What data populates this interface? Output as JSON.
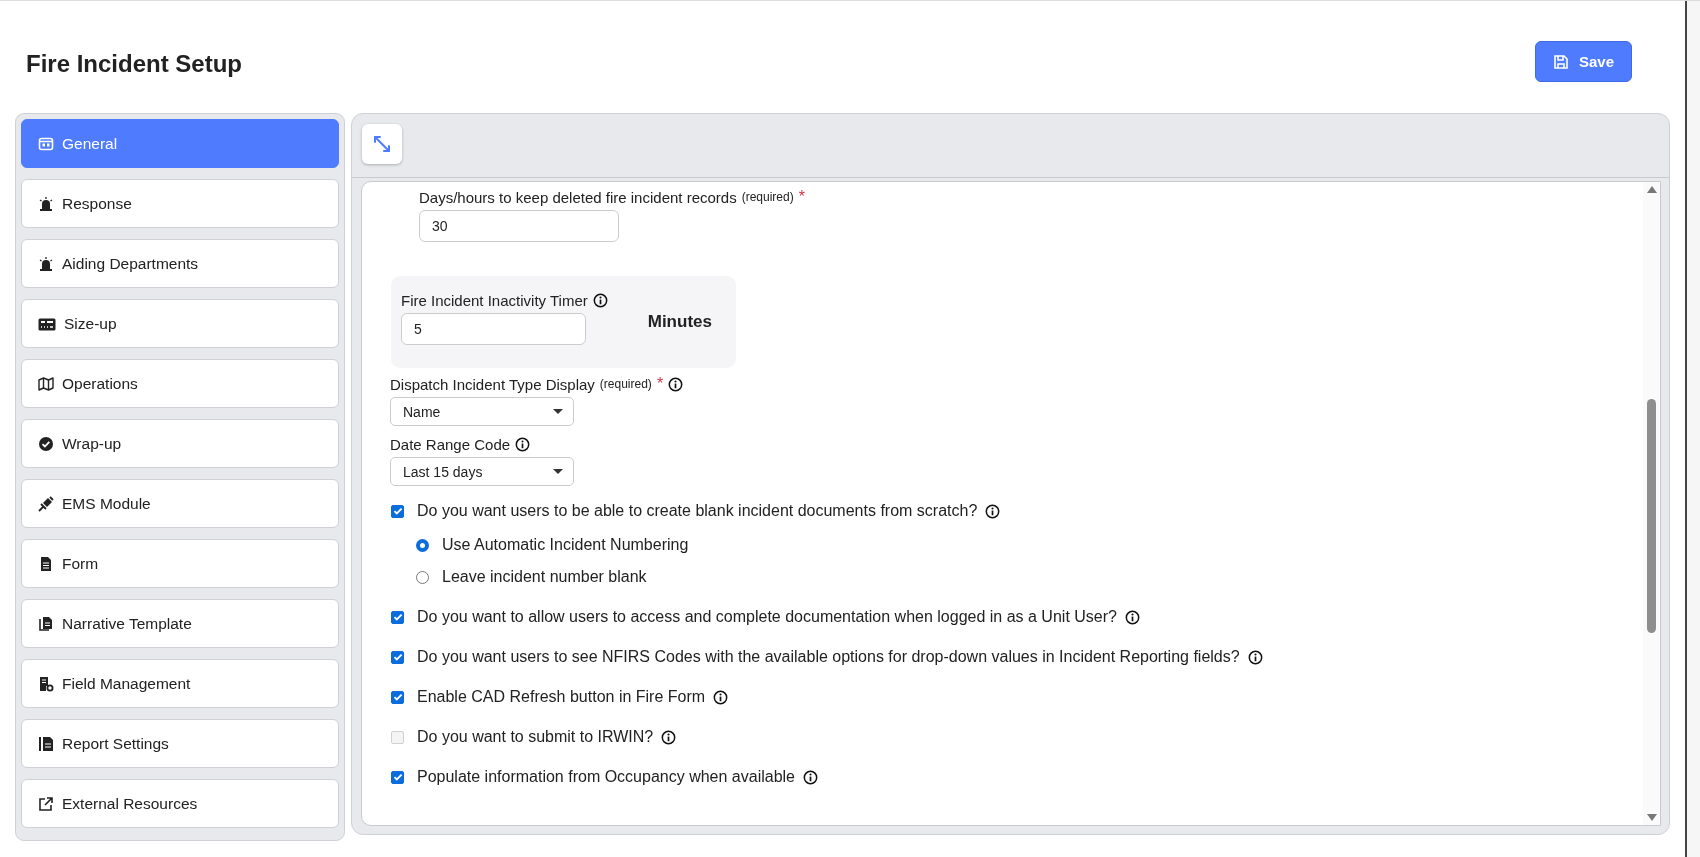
{
  "page": {
    "title": "Fire Incident Setup",
    "save_button": "Save"
  },
  "sidebar": {
    "items": [
      {
        "label": "General",
        "selected": true
      },
      {
        "label": "Response",
        "selected": false
      },
      {
        "label": "Aiding Departments",
        "selected": false
      },
      {
        "label": "Size-up",
        "selected": false
      },
      {
        "label": "Operations",
        "selected": false
      },
      {
        "label": "Wrap-up",
        "selected": false
      },
      {
        "label": "EMS Module",
        "selected": false
      },
      {
        "label": "Form",
        "selected": false
      },
      {
        "label": "Narrative Template",
        "selected": false
      },
      {
        "label": "Field Management",
        "selected": false
      },
      {
        "label": "Report Settings",
        "selected": false
      },
      {
        "label": "External Resources",
        "selected": false
      }
    ]
  },
  "content": {
    "retention": {
      "label": "Days/hours to keep deleted fire incident records",
      "required_note": "(required)",
      "required_mark": "*",
      "value": "30"
    },
    "inactivity": {
      "label": "Fire Incident Inactivity Timer",
      "value": "5",
      "unit": "Minutes"
    },
    "dispatch_type": {
      "label": "Dispatch Incident Type Display",
      "required_note": "(required)",
      "required_mark": "*",
      "value": "Name"
    },
    "date_range": {
      "label": "Date Range Code",
      "value": "Last 15 days"
    },
    "options": [
      {
        "label": "Do you want users to be able to create blank incident documents from scratch?",
        "checked": true,
        "disabled": false,
        "choices": [
          {
            "label": "Use Automatic Incident Numbering",
            "selected": true
          },
          {
            "label": "Leave incident number blank",
            "selected": false
          }
        ]
      },
      {
        "label": "Do you want to allow users to access and complete documentation when logged in as a Unit User?",
        "checked": true,
        "disabled": false
      },
      {
        "label": "Do you want users to see NFIRS Codes with the available options for drop-down values in Incident Reporting fields?",
        "checked": true,
        "disabled": false
      },
      {
        "label": "Enable CAD Refresh button in Fire Form",
        "checked": true,
        "disabled": false
      },
      {
        "label": "Do you want to submit to IRWIN?",
        "checked": false,
        "disabled": true
      },
      {
        "label": "Populate information from Occupancy when available",
        "checked": true,
        "disabled": false
      }
    ]
  }
}
